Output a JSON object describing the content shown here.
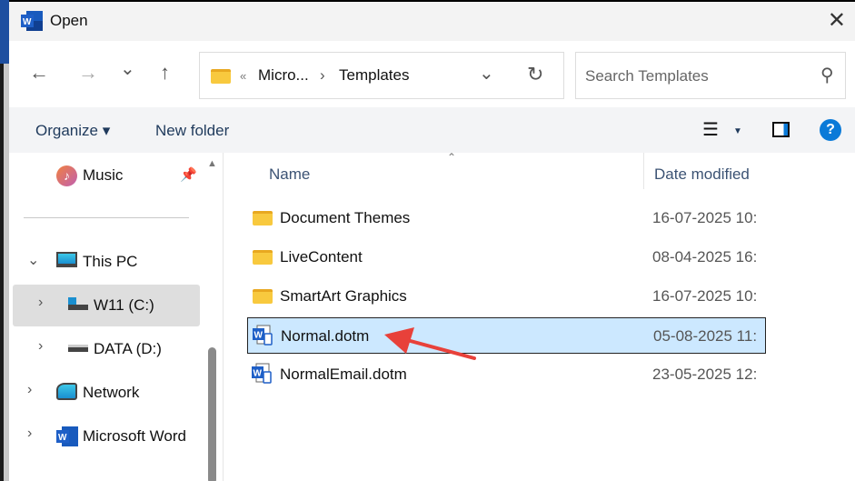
{
  "window": {
    "title": "Open",
    "close": "✕"
  },
  "nav": {
    "back": "←",
    "forward": "→",
    "recent": "⌄",
    "up": "↑"
  },
  "address": {
    "overflow": "«",
    "segments": [
      "Micro...",
      "Templates"
    ],
    "separator": "›",
    "dropdown": "⌄",
    "refresh": "↻"
  },
  "search": {
    "placeholder": "Search Templates"
  },
  "toolbar": {
    "organize": "Organize ▾",
    "new_folder": "New folder",
    "help": "?"
  },
  "sidebar": {
    "items": [
      {
        "label": "Music"
      },
      {
        "label": "This PC"
      },
      {
        "label": "W11 (C:)"
      },
      {
        "label": "DATA (D:)"
      },
      {
        "label": "Network"
      },
      {
        "label": "Microsoft Word"
      }
    ]
  },
  "columns": {
    "name": "Name",
    "date": "Date modified"
  },
  "files": [
    {
      "name": "Document Themes",
      "date": "16-07-2025 10:",
      "type": "folder"
    },
    {
      "name": "LiveContent",
      "date": "08-04-2025 16:",
      "type": "folder"
    },
    {
      "name": "SmartArt Graphics",
      "date": "16-07-2025 10:",
      "type": "folder"
    },
    {
      "name": "Normal.dotm",
      "date": "05-08-2025 11:",
      "type": "word-template",
      "selected": true
    },
    {
      "name": "NormalEmail.dotm",
      "date": "23-05-2025 12:",
      "type": "word-template"
    }
  ],
  "colors": {
    "accent": "#0067c0",
    "selection": "#cce8ff",
    "annotation": "#e8413a"
  }
}
